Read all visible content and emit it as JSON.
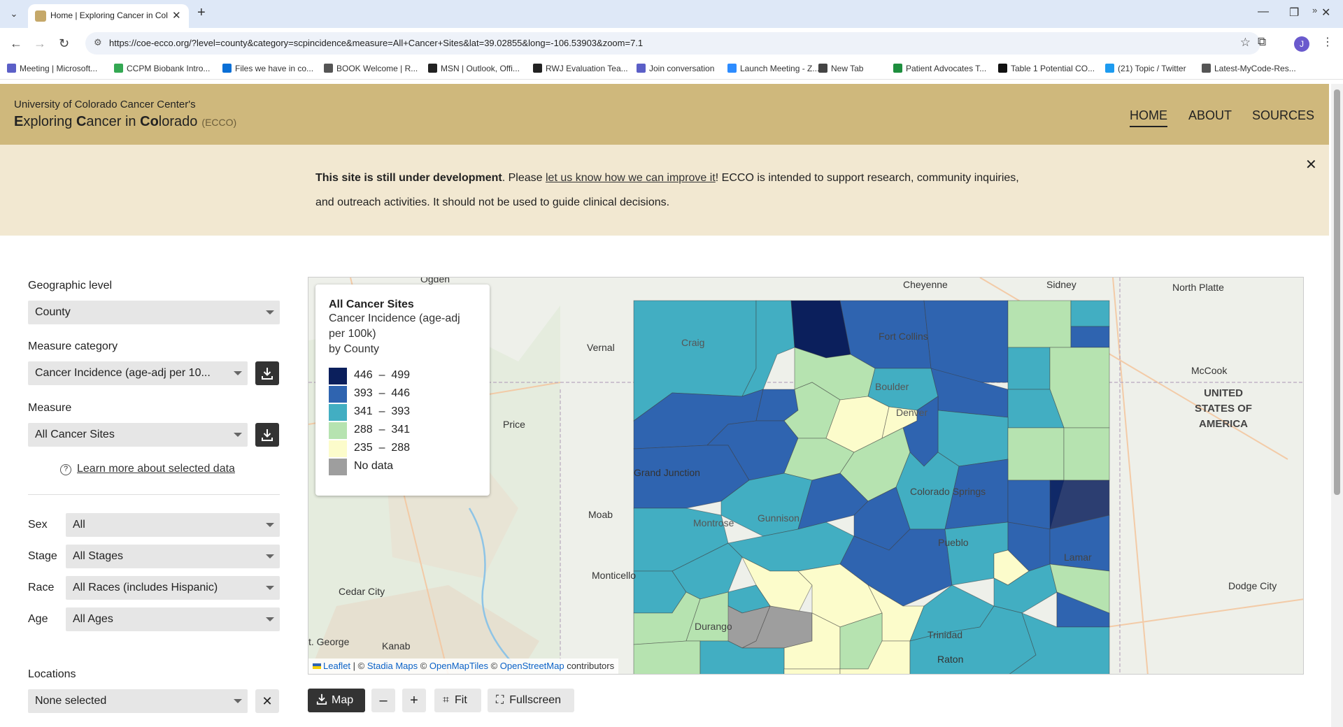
{
  "browser": {
    "tab_title": "Home | Exploring Cancer in Col",
    "url": "https://coe-ecco.org/?level=county&category=scpincidence&measure=All+Cancer+Sites&lat=39.02855&long=-106.53903&zoom=7.1",
    "profile_initial": "J",
    "bookmarks": [
      {
        "label": "Meeting | Microsoft...",
        "color": "#5b5fc7"
      },
      {
        "label": "CCPM Biobank Intro...",
        "color": "#34a853"
      },
      {
        "label": "Files we have in co...",
        "color": "#0a6fd6"
      },
      {
        "label": "BOOK Welcome | R...",
        "color": "#555555"
      },
      {
        "label": "MSN | Outlook, Offi...",
        "color": "#222222"
      },
      {
        "label": "RWJ Evaluation Tea...",
        "color": "#222222"
      },
      {
        "label": "Join conversation",
        "color": "#5b5fc7"
      },
      {
        "label": "Launch Meeting - Z...",
        "color": "#2d8cff"
      },
      {
        "label": "New Tab",
        "color": "#444444"
      },
      {
        "label": "Patient Advocates T...",
        "color": "#1e8e3e"
      },
      {
        "label": "Table 1 Potential CO...",
        "color": "#111111"
      },
      {
        "label": "(21) Topic / Twitter",
        "color": "#1d9bf0"
      },
      {
        "label": "Latest-MyCode-Res...",
        "color": "#555555"
      }
    ]
  },
  "header": {
    "subtitle": "University of Colorado Cancer Center's",
    "title_parts": [
      "E",
      "xploring ",
      "C",
      "ancer in ",
      "Co",
      "lorado"
    ],
    "abbr": "(ECCO)",
    "nav": [
      "HOME",
      "ABOUT",
      "SOURCES"
    ]
  },
  "banner": {
    "bold": "This site is still under development",
    "pre_link": ". Please ",
    "link": "let us know how we can improve it",
    "post_link": "! ECCO is intended to support research, community inquiries, and outreach activities. It should not be used to guide clinical decisions."
  },
  "controls": {
    "geo_label": "Geographic level",
    "geo_value": "County",
    "category_label": "Measure category",
    "category_value": "Cancer Incidence (age-adj per 10...",
    "measure_label": "Measure",
    "measure_value": "All Cancer Sites",
    "learn_more": "Learn more about selected data",
    "sex_label": "Sex",
    "sex_value": "All",
    "stage_label": "Stage",
    "stage_value": "All Stages",
    "race_label": "Race",
    "race_value": "All Races (includes Hispanic)",
    "age_label": "Age",
    "age_value": "All Ages",
    "locations_label": "Locations",
    "locations_value": "None selected"
  },
  "legend": {
    "title": "All Cancer Sites",
    "subtitle_lines": [
      "Cancer Incidence (age-adj",
      "per 100k)",
      "by County"
    ],
    "items": [
      {
        "range": "446  –  499",
        "color": "#0b1f5c"
      },
      {
        "range": "393  –  446",
        "color": "#2f64b0"
      },
      {
        "range": "341  –  393",
        "color": "#42aec2"
      },
      {
        "range": "288  –  341",
        "color": "#b6e3b0"
      },
      {
        "range": "235  –  288",
        "color": "#fcfccb"
      },
      {
        "range": "No data",
        "color": "#9e9e9e"
      }
    ]
  },
  "map_places": {
    "ogden": "Ogden",
    "cheyenne": "Cheyenne",
    "sidney": "Sidney",
    "north_platte": "North Platte",
    "vernal": "Vernal",
    "craig": "Craig",
    "fort_collins": "Fort Collins",
    "mccook": "McCook",
    "boulder": "Boulder",
    "denver": "Denver",
    "price": "Price",
    "usa": "UNITED\nSTATES OF\nAMERICA",
    "grand_junction": "Grand Junction",
    "colorado_springs": "Colorado Springs",
    "moab": "Moab",
    "montrose": "Montrose",
    "gunnison": "Gunnison",
    "pueblo": "Pueblo",
    "lamar": "Lamar",
    "monticello": "Monticello",
    "dodge_city": "Dodge City",
    "cedar_city": "Cedar City",
    "durango": "Durango",
    "trinidad": "Trinidad",
    "st_george": "t. George",
    "kanab": "Kanab",
    "raton": "Raton"
  },
  "attribution": {
    "leaflet": "Leaflet",
    "sep": " | © ",
    "stadia": "Stadia Maps",
    "c2": " © ",
    "omt": "OpenMapTiles",
    "c3": " © ",
    "osm": "OpenStreetMap",
    "tail": " contributors"
  },
  "toolbar": {
    "map_label": "Map",
    "zoom_out": "–",
    "zoom_in": "+",
    "fit": "Fit",
    "fullscreen": "Fullscreen"
  }
}
